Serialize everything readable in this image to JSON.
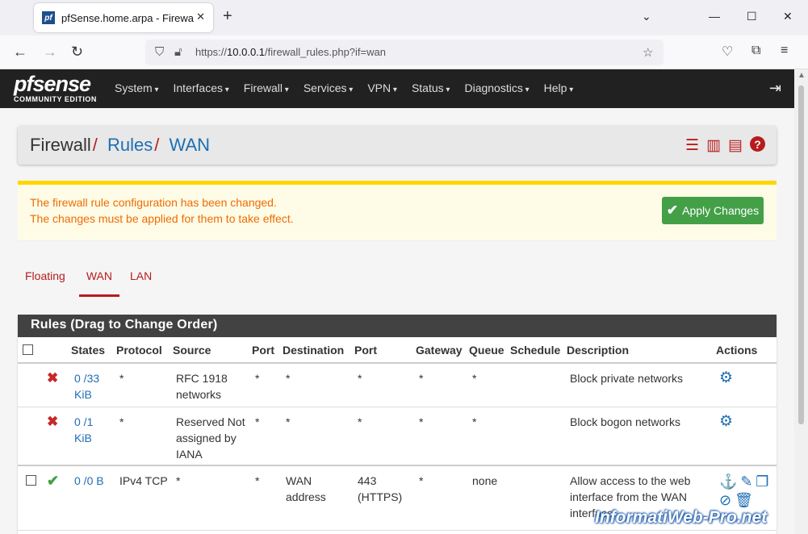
{
  "browser": {
    "tab_title": "pfSense.home.arpa - Firewall: R",
    "url_prefix": "https://",
    "url_host": "10.0.0.1",
    "url_path": "/firewall_rules.php?if=wan"
  },
  "app": {
    "logo_main": "pfsense",
    "logo_sub": "COMMUNITY EDITION",
    "menu": [
      "System",
      "Interfaces",
      "Firewall",
      "Services",
      "VPN",
      "Status",
      "Diagnostics",
      "Help"
    ]
  },
  "breadcrumb": {
    "root": "Firewall",
    "sep": "/",
    "level2": "Rules",
    "level3": "WAN"
  },
  "alert": {
    "line1": "The firewall rule configuration has been changed.",
    "line2": "The changes must be applied for them to take effect.",
    "apply_label": "Apply Changes"
  },
  "tabs": [
    "Floating",
    "WAN",
    "LAN"
  ],
  "active_tab": "WAN",
  "rules": {
    "title": "Rules (Drag to Change Order)",
    "headers": [
      "States",
      "Protocol",
      "Source",
      "Port",
      "Destination",
      "Port",
      "Gateway",
      "Queue",
      "Schedule",
      "Description",
      "Actions"
    ],
    "rows": [
      {
        "status": "blocked",
        "states": "0 /33 KiB",
        "protocol": "*",
        "source": "RFC 1918 networks",
        "sport": "*",
        "dest": "*",
        "dport": "*",
        "gateway": "*",
        "queue": "*",
        "schedule": "",
        "description": "Block private networks"
      },
      {
        "status": "blocked",
        "states": "0 /1 KiB",
        "protocol": "*",
        "source": "Reserved Not assigned by IANA",
        "sport": "*",
        "dest": "*",
        "dport": "*",
        "gateway": "*",
        "queue": "*",
        "schedule": "",
        "description": "Block bogon networks"
      },
      {
        "status": "pass",
        "states": "0 /0 B",
        "protocol": "IPv4 TCP",
        "source": "*",
        "sport": "*",
        "dest": "WAN address",
        "dport": "443 (HTTPS)",
        "gateway": "*",
        "queue": "none",
        "schedule": "",
        "description": "Allow access to the web interface from the WAN interface"
      }
    ]
  },
  "watermark": "InformatiWeb-Pro.net"
}
